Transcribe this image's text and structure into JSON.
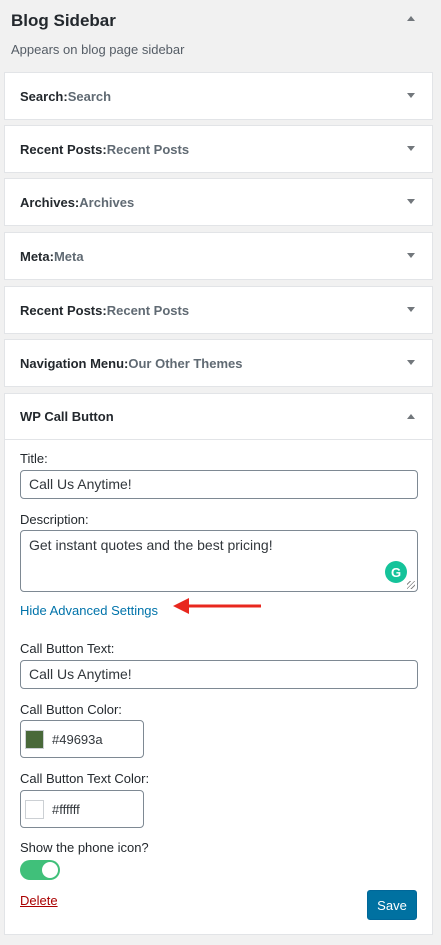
{
  "sidebar": {
    "title": "Blog Sidebar",
    "description": "Appears on blog page sidebar"
  },
  "widgets": [
    {
      "name": "Search",
      "sep": ": ",
      "instance": "Search"
    },
    {
      "name": "Recent Posts",
      "sep": ": ",
      "instance": "Recent Posts"
    },
    {
      "name": "Archives",
      "sep": ": ",
      "instance": "Archives"
    },
    {
      "name": "Meta",
      "sep": ": ",
      "instance": "Meta"
    },
    {
      "name": "Recent Posts",
      "sep": ": ",
      "instance": "Recent Posts"
    },
    {
      "name": "Navigation Menu",
      "sep": ": ",
      "instance": "Our Other Themes"
    }
  ],
  "open_widget": {
    "name": "WP Call Button",
    "title_label": "Title:",
    "title_value": "Call Us Anytime!",
    "description_label": "Description:",
    "description_value": "Get instant quotes and the best pricing!",
    "advanced_link": "Hide Advanced Settings",
    "button_text_label": "Call Button Text:",
    "button_text_value": "Call Us Anytime!",
    "button_color_label": "Call Button Color:",
    "button_color_value": "#49693a",
    "text_color_label": "Call Button Text Color:",
    "text_color_value": "#ffffff",
    "phone_icon_label": "Show the phone icon?",
    "phone_icon_on": true,
    "delete_label": "Delete",
    "save_label": "Save"
  },
  "colors": {
    "accent": "#0073aa",
    "toggle_on": "#40c07a",
    "annotation_arrow": "#e8271e",
    "delete": "#aa0000"
  }
}
